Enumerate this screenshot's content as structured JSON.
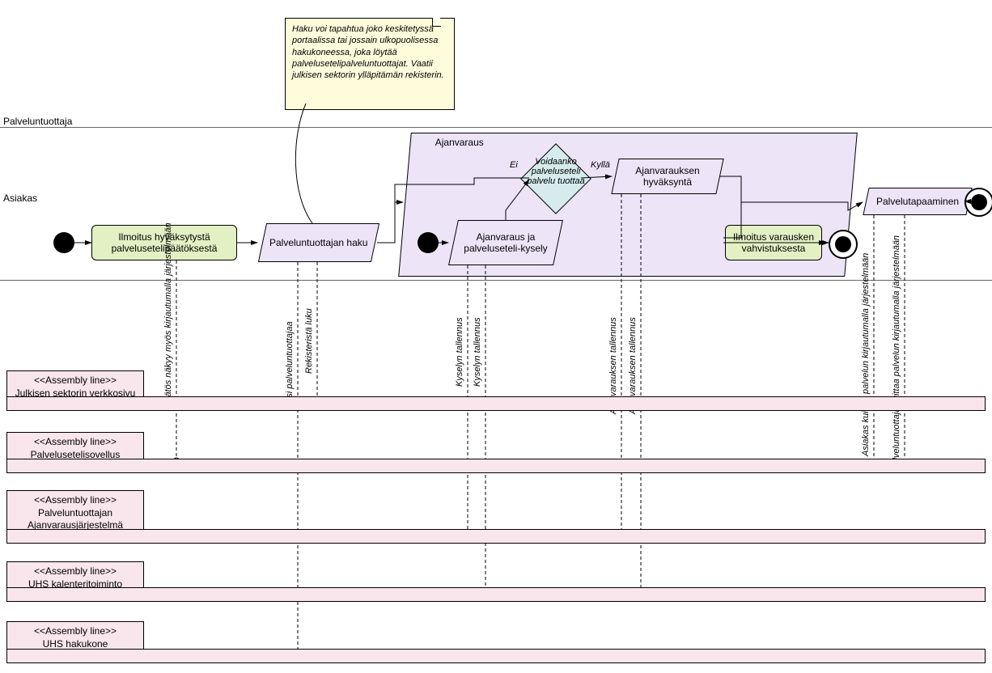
{
  "lanes": {
    "provider": "Palveluntuottaja",
    "customer": "Asiakas"
  },
  "note": "Haku voi tapahtua joko keskitetyssä portaalissa tai jossain ulkopuolisessa hakukoneessa, joka löytää palvelusetelipalveluntuottajat. Vaatii julkisen sektorin ylläpitämän rekisterin.",
  "activities": {
    "a1": "Ilmoitus hyväksytystä palvelusetelipäätöksestä",
    "a2": "Palveluntuottajan haku",
    "a3": "Ajanvaraus ja palveluseteli-kysely",
    "a4": "Ajanvarauksen hyväksyntä",
    "a5": "Ilmoitus varausken vahvistuksesta",
    "a6": "Palvelutapaaminen"
  },
  "container": "Ajanvaraus",
  "decision": {
    "text": "Voidaanko palveluseteli palvelu tuottaa",
    "no": "Ei",
    "yes": "Kyllä"
  },
  "assemblies": {
    "l1a": "<<Assembly line>>",
    "l1b": "Julkisen sektorin verkkosivu",
    "l2a": "<<Assembly line>>",
    "l2b": "Palvelusetelisovellus",
    "l3a": "<<Assembly line>>",
    "l3b": "Palveluntuottajan Ajanvarausjärjestelmä",
    "l4a": "<<Assembly line>>",
    "l4b": "UHS kalenteritoiminto",
    "l5a": "<<Assembly line>>",
    "l5b": "UHS hakukone"
  },
  "vlabels": {
    "v1": "Päätös näkyy myös kirjautumalla järjestelmään",
    "v2": "Etsi palveluntuottajaa",
    "v3": "Rekisteristä luku",
    "v4": "Kyselyn tallennus",
    "v5": "Kyselyn tallennus",
    "v6": "Ajanvarauksen tallennus",
    "v7": "Ajanvarauksen tallennus",
    "v8": "Asiakas kuittaa palvelun kirjautumalla järjestelmään",
    "v9": "Palveluntuottaja kuittaa palvelun kirjautumalla järjestelmään"
  }
}
